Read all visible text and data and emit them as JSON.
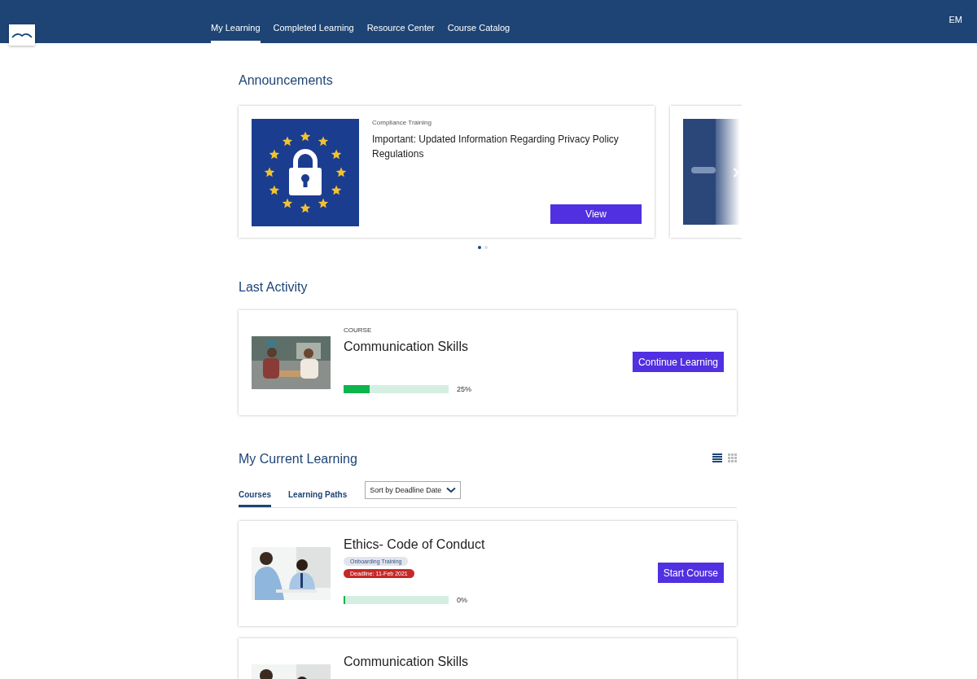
{
  "nav": {
    "tabs": [
      {
        "label": "My Learning",
        "selected": true
      },
      {
        "label": "Completed Learning",
        "selected": false
      },
      {
        "label": "Resource Center",
        "selected": false
      },
      {
        "label": "Course Catalog",
        "selected": false
      }
    ],
    "user_initials": "EM"
  },
  "announcements": {
    "title": "Announcements",
    "items": [
      {
        "category": "Compliance Training",
        "headline": "Important: Updated Information Regarding Privacy Policy Regulations",
        "button": "View"
      }
    ],
    "dots": [
      {
        "selected": true
      },
      {
        "selected": false
      }
    ]
  },
  "last_activity": {
    "title": "Last Activity",
    "type": "COURSE",
    "name": "Communication Skills",
    "level": 0.25,
    "progress": "25%",
    "button": "Continue Learning"
  },
  "current_learning": {
    "title": "My Current Learning",
    "view_modes": [
      {
        "kind": "list",
        "selected": true
      },
      {
        "kind": "grid",
        "selected": false
      }
    ],
    "tabs": [
      {
        "label": "Courses",
        "selected": true
      },
      {
        "label": "Learning Paths",
        "selected": false
      }
    ],
    "sort": "Sort by Deadline Date",
    "courses": [
      {
        "name": "Ethics- Code of Conduct",
        "tag": "Onboarding Training",
        "deadline": "Deadline: 11-Feb 2021",
        "level": 0,
        "progress": "0%",
        "button": "Start Course"
      },
      {
        "name": "Communication Skills"
      }
    ]
  }
}
